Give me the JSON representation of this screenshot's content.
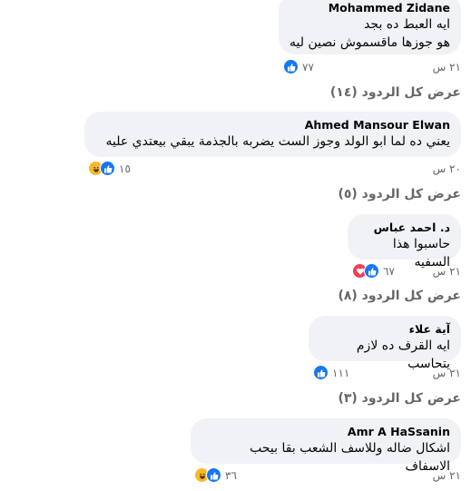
{
  "comments": [
    {
      "author": "Mohammed Zidane",
      "line1": "ايه العبط ده بجد",
      "line2": "هو جوزها ماقسموش نصين ليه",
      "time": "٢١ س",
      "reaction_count": "٧٧",
      "reactions": [
        "like-icon"
      ],
      "replies": "عرض كل الردود (١٤)"
    },
    {
      "author": "Ahmed Mansour Elwan",
      "line1": "يعني ده لما ابو الولد وجوز الست يضربه بالجذمة يبقي بيعتدي عليه",
      "time": "٢٠ س",
      "reaction_count": "١٥",
      "reactions": [
        "like-icon",
        "haha-icon"
      ],
      "replies": "عرض كل الردود (٥)"
    },
    {
      "author": "د. احمد عباس",
      "line1": "حاسبوا هذا السفيه",
      "time": "٢١ س",
      "reaction_count": "٦٧",
      "reactions": [
        "like-icon",
        "love-icon"
      ],
      "replies": "عرض كل الردود (٨)"
    },
    {
      "author": "آية علاء",
      "line1": "ايه القرف ده لازم يتحاسب",
      "time": "٢١ س",
      "reaction_count": "١١١",
      "reactions": [
        "like-icon"
      ],
      "replies": "عرض كل الردود (٣)"
    },
    {
      "author": "Amr A HaSsanin",
      "line1": "اشكال ضاله وللاسف الشعب بقا بيحب الاسفاف",
      "time": "٢١ س",
      "reaction_count": "٣٦",
      "reactions": [
        "like-icon",
        "haha-icon"
      ]
    }
  ],
  "colors": {
    "like": "#1877f2",
    "haha": "#f7b928",
    "love": "#f33e58",
    "bubble": "#f0f2f5",
    "secondary": "#65676b"
  }
}
